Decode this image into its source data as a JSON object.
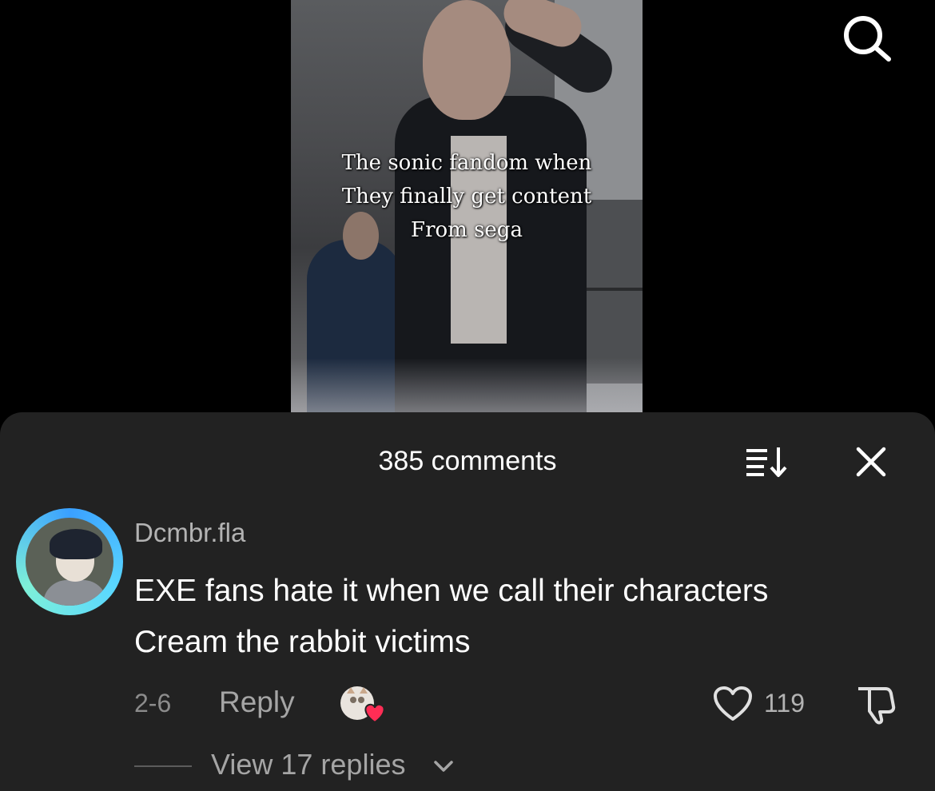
{
  "video": {
    "caption_lines": [
      "The sonic fandom when",
      "They finally get content",
      "From sega"
    ]
  },
  "header": {
    "search_icon": "search-icon"
  },
  "comments_sheet": {
    "title": "385 comments",
    "sort_icon": "sort-icon",
    "close_icon": "close-icon"
  },
  "comment": {
    "username": "Dcmbr.fla",
    "text_line1": "EXE fans hate it when we call their characters",
    "text_line2": "Cream the rabbit victims",
    "date": "2-6",
    "reply_label": "Reply",
    "like_count": "119",
    "view_replies_label": "View 17 replies"
  },
  "colors": {
    "sheet_bg": "#222222",
    "like_heart": "#ff2d55",
    "avatar_ring": "#3aa0ff"
  }
}
